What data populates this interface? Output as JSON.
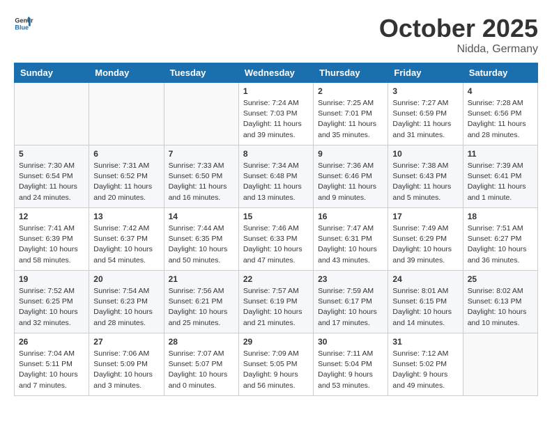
{
  "header": {
    "logo_general": "General",
    "logo_blue": "Blue",
    "month": "October 2025",
    "location": "Nidda, Germany"
  },
  "days_of_week": [
    "Sunday",
    "Monday",
    "Tuesday",
    "Wednesday",
    "Thursday",
    "Friday",
    "Saturday"
  ],
  "weeks": [
    [
      {
        "day": "",
        "info": ""
      },
      {
        "day": "",
        "info": ""
      },
      {
        "day": "",
        "info": ""
      },
      {
        "day": "1",
        "info": "Sunrise: 7:24 AM\nSunset: 7:03 PM\nDaylight: 11 hours and 39 minutes."
      },
      {
        "day": "2",
        "info": "Sunrise: 7:25 AM\nSunset: 7:01 PM\nDaylight: 11 hours and 35 minutes."
      },
      {
        "day": "3",
        "info": "Sunrise: 7:27 AM\nSunset: 6:59 PM\nDaylight: 11 hours and 31 minutes."
      },
      {
        "day": "4",
        "info": "Sunrise: 7:28 AM\nSunset: 6:56 PM\nDaylight: 11 hours and 28 minutes."
      }
    ],
    [
      {
        "day": "5",
        "info": "Sunrise: 7:30 AM\nSunset: 6:54 PM\nDaylight: 11 hours and 24 minutes."
      },
      {
        "day": "6",
        "info": "Sunrise: 7:31 AM\nSunset: 6:52 PM\nDaylight: 11 hours and 20 minutes."
      },
      {
        "day": "7",
        "info": "Sunrise: 7:33 AM\nSunset: 6:50 PM\nDaylight: 11 hours and 16 minutes."
      },
      {
        "day": "8",
        "info": "Sunrise: 7:34 AM\nSunset: 6:48 PM\nDaylight: 11 hours and 13 minutes."
      },
      {
        "day": "9",
        "info": "Sunrise: 7:36 AM\nSunset: 6:46 PM\nDaylight: 11 hours and 9 minutes."
      },
      {
        "day": "10",
        "info": "Sunrise: 7:38 AM\nSunset: 6:43 PM\nDaylight: 11 hours and 5 minutes."
      },
      {
        "day": "11",
        "info": "Sunrise: 7:39 AM\nSunset: 6:41 PM\nDaylight: 11 hours and 1 minute."
      }
    ],
    [
      {
        "day": "12",
        "info": "Sunrise: 7:41 AM\nSunset: 6:39 PM\nDaylight: 10 hours and 58 minutes."
      },
      {
        "day": "13",
        "info": "Sunrise: 7:42 AM\nSunset: 6:37 PM\nDaylight: 10 hours and 54 minutes."
      },
      {
        "day": "14",
        "info": "Sunrise: 7:44 AM\nSunset: 6:35 PM\nDaylight: 10 hours and 50 minutes."
      },
      {
        "day": "15",
        "info": "Sunrise: 7:46 AM\nSunset: 6:33 PM\nDaylight: 10 hours and 47 minutes."
      },
      {
        "day": "16",
        "info": "Sunrise: 7:47 AM\nSunset: 6:31 PM\nDaylight: 10 hours and 43 minutes."
      },
      {
        "day": "17",
        "info": "Sunrise: 7:49 AM\nSunset: 6:29 PM\nDaylight: 10 hours and 39 minutes."
      },
      {
        "day": "18",
        "info": "Sunrise: 7:51 AM\nSunset: 6:27 PM\nDaylight: 10 hours and 36 minutes."
      }
    ],
    [
      {
        "day": "19",
        "info": "Sunrise: 7:52 AM\nSunset: 6:25 PM\nDaylight: 10 hours and 32 minutes."
      },
      {
        "day": "20",
        "info": "Sunrise: 7:54 AM\nSunset: 6:23 PM\nDaylight: 10 hours and 28 minutes."
      },
      {
        "day": "21",
        "info": "Sunrise: 7:56 AM\nSunset: 6:21 PM\nDaylight: 10 hours and 25 minutes."
      },
      {
        "day": "22",
        "info": "Sunrise: 7:57 AM\nSunset: 6:19 PM\nDaylight: 10 hours and 21 minutes."
      },
      {
        "day": "23",
        "info": "Sunrise: 7:59 AM\nSunset: 6:17 PM\nDaylight: 10 hours and 17 minutes."
      },
      {
        "day": "24",
        "info": "Sunrise: 8:01 AM\nSunset: 6:15 PM\nDaylight: 10 hours and 14 minutes."
      },
      {
        "day": "25",
        "info": "Sunrise: 8:02 AM\nSunset: 6:13 PM\nDaylight: 10 hours and 10 minutes."
      }
    ],
    [
      {
        "day": "26",
        "info": "Sunrise: 7:04 AM\nSunset: 5:11 PM\nDaylight: 10 hours and 7 minutes."
      },
      {
        "day": "27",
        "info": "Sunrise: 7:06 AM\nSunset: 5:09 PM\nDaylight: 10 hours and 3 minutes."
      },
      {
        "day": "28",
        "info": "Sunrise: 7:07 AM\nSunset: 5:07 PM\nDaylight: 10 hours and 0 minutes."
      },
      {
        "day": "29",
        "info": "Sunrise: 7:09 AM\nSunset: 5:05 PM\nDaylight: 9 hours and 56 minutes."
      },
      {
        "day": "30",
        "info": "Sunrise: 7:11 AM\nSunset: 5:04 PM\nDaylight: 9 hours and 53 minutes."
      },
      {
        "day": "31",
        "info": "Sunrise: 7:12 AM\nSunset: 5:02 PM\nDaylight: 9 hours and 49 minutes."
      },
      {
        "day": "",
        "info": ""
      }
    ]
  ]
}
